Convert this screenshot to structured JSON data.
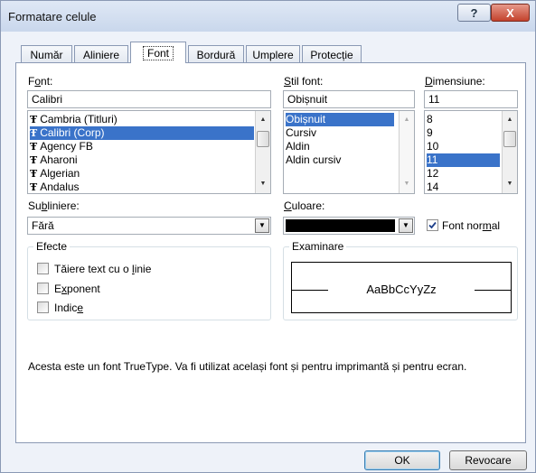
{
  "window": {
    "title": "Formatare celule",
    "help_label": "?",
    "close_label": "X"
  },
  "tabs": [
    {
      "label": "Număr"
    },
    {
      "label": "Aliniere"
    },
    {
      "label": "Font",
      "active": true
    },
    {
      "label": "Bordură"
    },
    {
      "label": "Umplere"
    },
    {
      "label": "Protecție"
    }
  ],
  "font": {
    "label_pre": "F",
    "label_acc": "o",
    "label_post": "nt:",
    "value": "Calibri",
    "items": [
      "Cambria (Titluri)",
      "Calibri (Corp)",
      "Agency FB",
      "Aharoni",
      "Algerian",
      "Andalus"
    ],
    "selected": "Calibri (Corp)",
    "item_icon": "truetype-icon",
    "item_icon_glyph": "Ŧ"
  },
  "style": {
    "label_pre": "",
    "label_acc": "S",
    "label_post": "til font:",
    "value": "Obișnuit",
    "items": [
      "Obișnuit",
      "Cursiv",
      "Aldin",
      "Aldin cursiv"
    ],
    "selected": "Obișnuit"
  },
  "size": {
    "label_pre": "",
    "label_acc": "D",
    "label_post": "imensiune:",
    "value": "11",
    "items": [
      "8",
      "9",
      "10",
      "11",
      "12",
      "14"
    ],
    "selected": "11"
  },
  "underline": {
    "label_pre": "Su",
    "label_acc": "b",
    "label_post": "liniere:",
    "value": "Fără"
  },
  "color": {
    "label_pre": "",
    "label_acc": "C",
    "label_post": "uloare:",
    "swatch": "#000000"
  },
  "normal_font": {
    "label_pre": "Font nor",
    "label_acc": "m",
    "label_post": "al",
    "checked": true
  },
  "effects": {
    "title": "Efecte",
    "items": [
      {
        "pre": "Tăiere text cu o ",
        "acc": "l",
        "post": "inie",
        "checked": false
      },
      {
        "pre": "E",
        "acc": "x",
        "post": "ponent",
        "checked": false
      },
      {
        "pre": "Indic",
        "acc": "e",
        "post": "",
        "checked": false
      }
    ]
  },
  "preview": {
    "title": "Examinare",
    "sample": "AaBbCcYyZz"
  },
  "description": "Acesta este un font TrueType. Va fi utilizat același font și pentru imprimantă și pentru ecran.",
  "buttons": {
    "ok": "OK",
    "cancel": "Revocare"
  },
  "colors": {
    "selection": "#3a73c9",
    "accent": "#3c7fb1",
    "close": "#c4422c"
  }
}
